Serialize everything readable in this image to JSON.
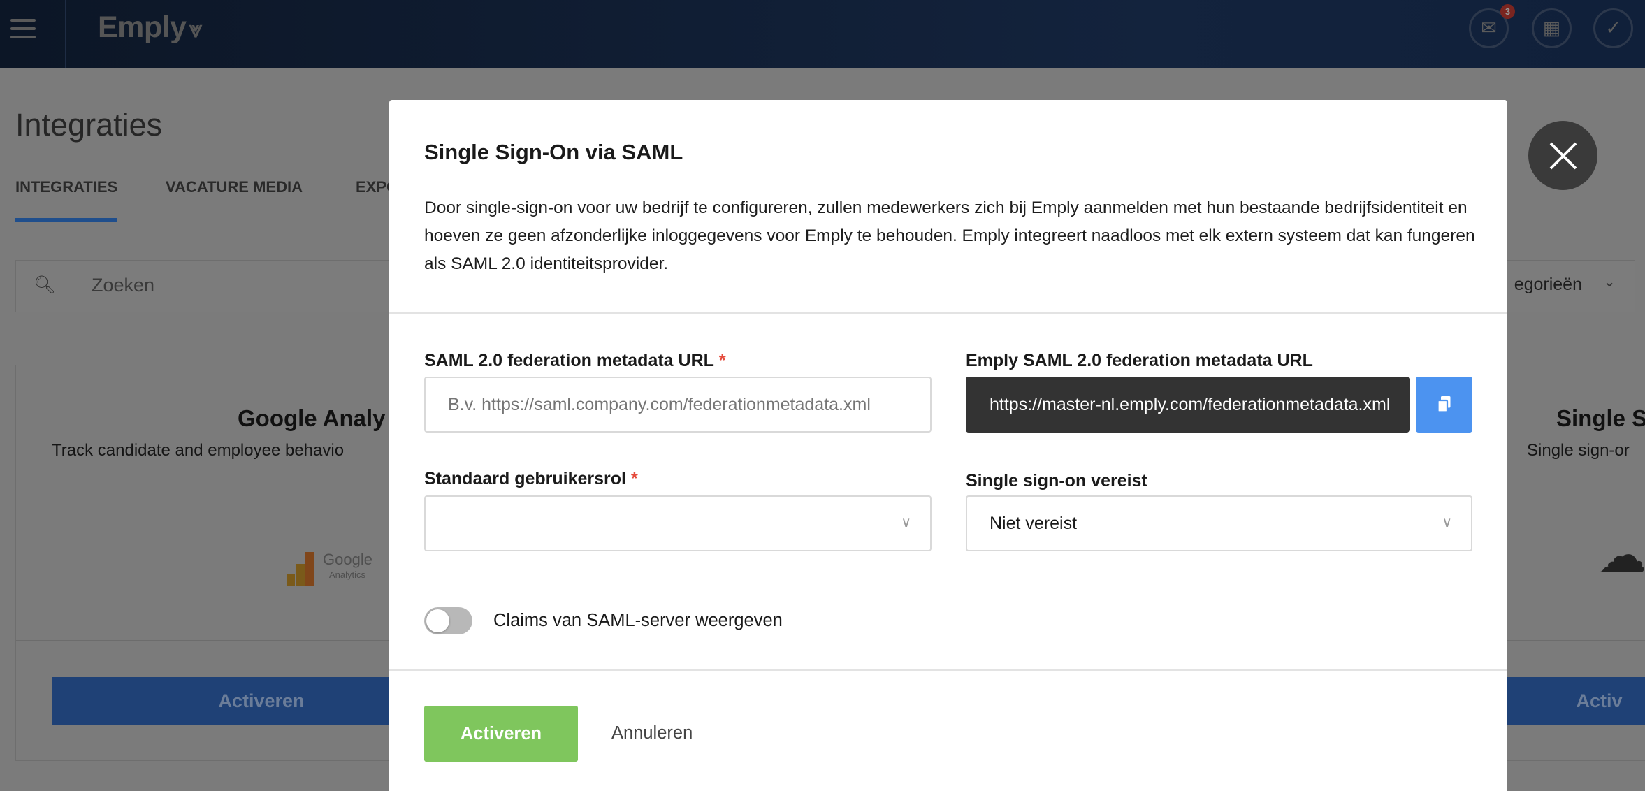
{
  "header": {
    "logo": "Emply",
    "mail_badge": "3",
    "icons": [
      "menu-icon",
      "mail-icon",
      "calendar-icon",
      "check-icon"
    ]
  },
  "page": {
    "title": "Integraties",
    "tabs": [
      {
        "label": "INTEGRATIES",
        "active": true
      },
      {
        "label": "VACATURE MEDIA"
      },
      {
        "label": "EXPO"
      }
    ],
    "search_placeholder": "Zoeken",
    "category_select": "egorieën"
  },
  "cards": [
    {
      "title": "Google Analy",
      "desc": "Track candidate and employee behavio",
      "logo_text": "Google",
      "logo_sub": "Analytics",
      "button": "Activeren"
    },
    {
      "title": "Single S",
      "desc": "Single sign-or",
      "button": "Activ"
    }
  ],
  "modal": {
    "title": "Single Sign-On via SAML",
    "description": "Door single-sign-on voor uw bedrijf te configureren, zullen medewerkers zich bij Emply aanmelden met hun bestaande bedrijfsidentiteit en hoeven ze geen afzonderlijke inloggegevens voor Emply te behouden. Emply integreert naadloos met elk extern systeem dat kan fungeren als SAML 2.0 identiteitsprovider.",
    "saml_url_label": "SAML 2.0 federation metadata URL",
    "saml_url_placeholder": "B.v. https://saml.company.com/federationmetadata.xml",
    "saml_url_value": "",
    "emply_url_label": "Emply SAML 2.0 federation metadata URL",
    "emply_url_value": "https://master-nl.emply.com/federationmetadata.xml",
    "role_label": "Standaard gebruikersrol",
    "role_value": "",
    "sso_label": "Single sign-on vereist",
    "sso_value": "Niet vereist",
    "required_mark": "*",
    "claims_toggle_label": "Claims van SAML-server weergeven",
    "claims_toggle_on": false,
    "activate": "Activeren",
    "cancel": "Annuleren"
  },
  "colors": {
    "accent": "#4c93f0",
    "activate": "#7fc65d",
    "required": "#e54b3c",
    "header": "#13233d"
  }
}
